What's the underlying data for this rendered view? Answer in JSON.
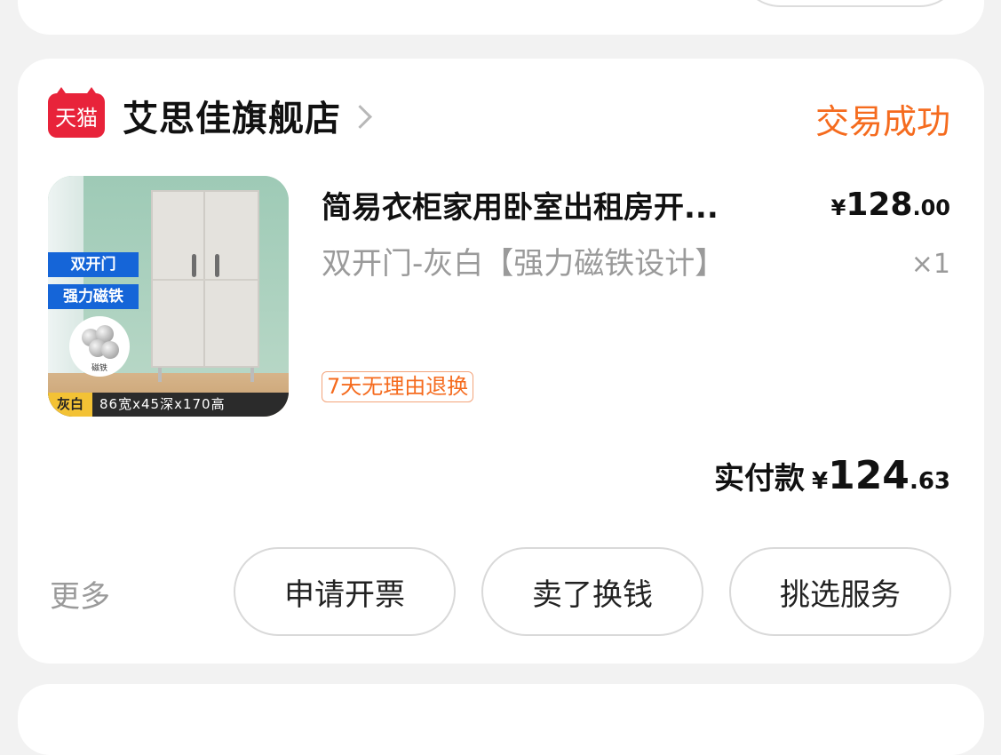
{
  "order": {
    "store": {
      "badge": "天猫",
      "name": "艾思佳旗舰店"
    },
    "status": "交易成功",
    "item": {
      "title": "简易衣柜家用卧室出租房开...",
      "price_currency": "¥",
      "price_int": "128",
      "price_dec": ".00",
      "variant": "双开门-灰白【强力磁铁设计】",
      "quantity": "×1",
      "return_policy": "7天无理由退换",
      "image": {
        "tag1": "双开门",
        "tag2": "强力磁铁",
        "magnet_label": "磁铁",
        "color_chip": "灰白",
        "dimensions": "86宽x45深x170高"
      }
    },
    "payment": {
      "label": "实付款",
      "currency": "¥",
      "int": "124",
      "dec": ".63"
    },
    "actions": {
      "more": "更多",
      "invoice": "申请开票",
      "sell": "卖了换钱",
      "service": "挑选服务"
    }
  },
  "colors": {
    "status": "#f56b1e",
    "tmall_red": "#e8233a",
    "background": "#f2f2f2"
  },
  "icons": [
    "tmall-logo-icon",
    "chevron-right-icon"
  ]
}
